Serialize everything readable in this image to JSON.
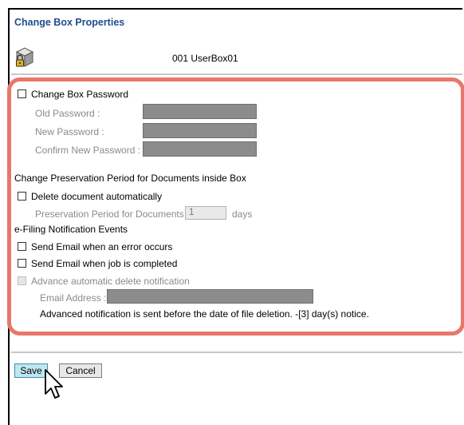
{
  "header": {
    "title": "Change Box Properties"
  },
  "box": {
    "name": "001 UserBox01",
    "icon": "locked-box-icon"
  },
  "password": {
    "checkbox_label": "Change Box Password",
    "old_label": "Old Password :",
    "new_label": "New Password :",
    "confirm_label": "Confirm New Password :"
  },
  "preservation": {
    "heading": "Change Preservation Period for Documents inside Box",
    "auto_delete_label": "Delete document automatically",
    "period_label": "Preservation Period for Documents :",
    "period_value": "1",
    "period_unit": "days"
  },
  "notifications": {
    "heading": "e-Filing Notification Events",
    "error_label": "Send Email when an error occurs",
    "completed_label": "Send Email when job is completed",
    "advance_label": "Advance automatic delete notification",
    "email_label": "Email Address :",
    "advance_note": "Advanced notification is sent before the date of file deletion. -[3] day(s) notice."
  },
  "actions": {
    "save_label": "Save",
    "cancel_label": "Cancel"
  },
  "colors": {
    "title": "#1f4e8c",
    "highlight": "#e8776a",
    "save_button": "#bfe6f2"
  }
}
